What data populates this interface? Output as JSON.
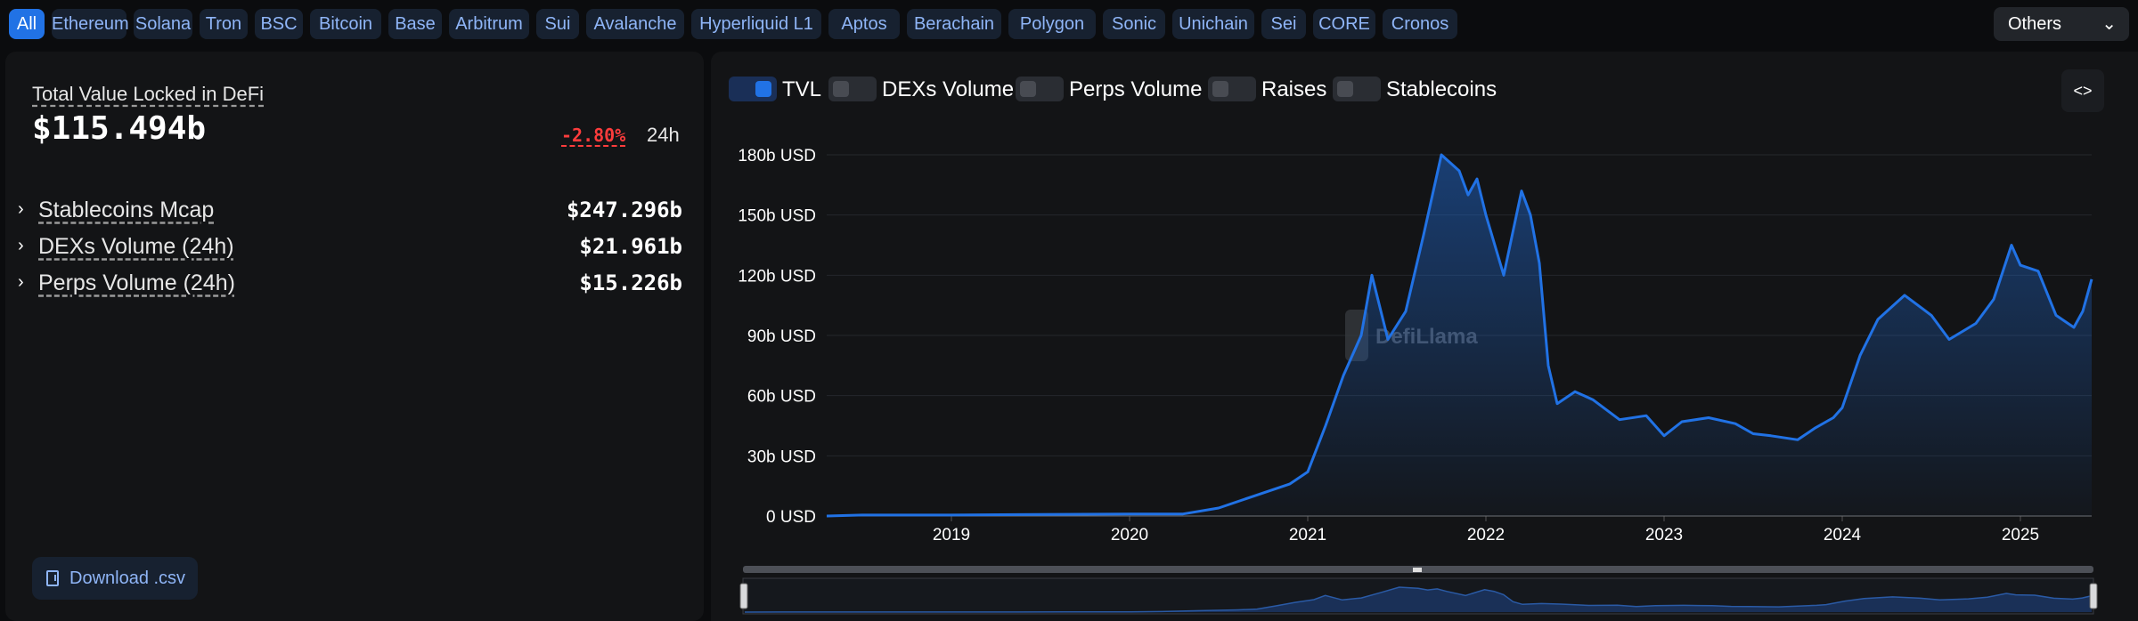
{
  "chains": {
    "items": [
      "All",
      "Ethereum",
      "Solana",
      "Tron",
      "BSC",
      "Bitcoin",
      "Base",
      "Arbitrum",
      "Sui",
      "Avalanche",
      "Hyperliquid L1",
      "Aptos",
      "Berachain",
      "Polygon",
      "Sonic",
      "Unichain",
      "Sei",
      "CORE",
      "Cronos"
    ],
    "others_label": "Others"
  },
  "summary": {
    "tvl_label": "Total Value Locked in DeFi",
    "tvl_value": "$115.494b",
    "change": "-2.80%",
    "period": "24h",
    "metrics": [
      {
        "label": "Stablecoins Mcap",
        "value": "$247.296b"
      },
      {
        "label": "DEXs Volume (24h)",
        "value": "$21.961b"
      },
      {
        "label": "Perps Volume (24h)",
        "value": "$15.226b"
      }
    ],
    "download_label": "Download .csv"
  },
  "toggles": [
    {
      "label": "TVL",
      "on": true
    },
    {
      "label": "DEXs Volume",
      "on": false
    },
    {
      "label": "Perps Volume",
      "on": false
    },
    {
      "label": "Raises",
      "on": false
    },
    {
      "label": "Stablecoins",
      "on": false
    }
  ],
  "embed_label": "<>",
  "watermark": "DefiLlama",
  "colors": {
    "accent": "#2172e5",
    "negative": "#fd3c3c",
    "chip_text": "#8fb5f7"
  },
  "chart_data": {
    "type": "area",
    "series": [
      {
        "name": "TVL",
        "x": [
          2018.3,
          2018.5,
          2019.0,
          2019.5,
          2020.0,
          2020.3,
          2020.5,
          2020.7,
          2020.9,
          2021.0,
          2021.1,
          2021.2,
          2021.3,
          2021.36,
          2021.45,
          2021.55,
          2021.65,
          2021.75,
          2021.85,
          2021.9,
          2021.95,
          2022.0,
          2022.1,
          2022.2,
          2022.25,
          2022.3,
          2022.35,
          2022.4,
          2022.5,
          2022.6,
          2022.75,
          2022.9,
          2023.0,
          2023.1,
          2023.25,
          2023.4,
          2023.5,
          2023.6,
          2023.75,
          2023.85,
          2023.95,
          2024.0,
          2024.1,
          2024.2,
          2024.35,
          2024.5,
          2024.6,
          2024.75,
          2024.85,
          2024.95,
          2025.0,
          2025.1,
          2025.2,
          2025.3,
          2025.35,
          2025.4
        ],
        "y": [
          0,
          0.5,
          0.5,
          0.8,
          1,
          1,
          4,
          10,
          16,
          22,
          45,
          70,
          90,
          120,
          88,
          102,
          140,
          180,
          172,
          160,
          168,
          150,
          120,
          162,
          150,
          126,
          75,
          56,
          62,
          58,
          48,
          50,
          40,
          47,
          49,
          46,
          41,
          40,
          38,
          44,
          49,
          54,
          80,
          98,
          110,
          100,
          88,
          96,
          108,
          135,
          125,
          122,
          100,
          94,
          102,
          118
        ]
      }
    ],
    "xticks": [
      "2019",
      "2020",
      "2021",
      "2022",
      "2023",
      "2024",
      "2025"
    ],
    "yticks": [
      "0 USD",
      "30b USD",
      "60b USD",
      "90b USD",
      "120b USD",
      "150b USD",
      "180b USD"
    ],
    "ylim": [
      0,
      180
    ],
    "xlim": [
      2018.3,
      2025.4
    ],
    "grid": "horizontal"
  }
}
